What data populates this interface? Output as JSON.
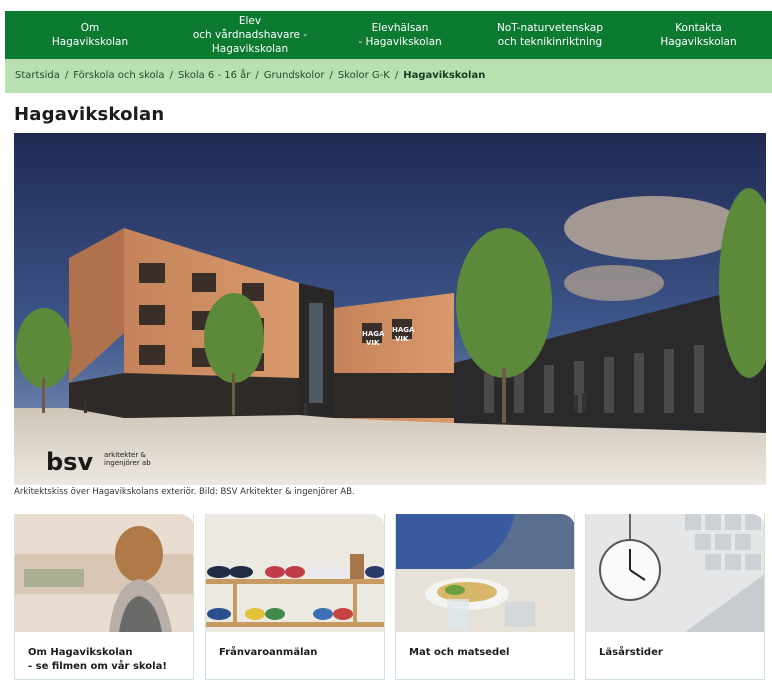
{
  "nav": {
    "items": [
      {
        "label": "Om\nHagavikskolan"
      },
      {
        "label": "Elev\noch vårdnadshavare -\nHagavikskolan"
      },
      {
        "label": "Elevhälsan\n- Hagavikskolan"
      },
      {
        "label": "NoT-naturvetenskap\noch teknikinriktning"
      },
      {
        "label": "Kontakta\nHagavikskolan"
      }
    ]
  },
  "breadcrumb": {
    "items": [
      "Startsida",
      "Förskola och skola",
      "Skola 6 - 16 år",
      "Grundskolor",
      "Skolor G-K"
    ],
    "separator": "/",
    "current": "Hagavikskolan"
  },
  "page": {
    "title": "Hagavikskolan"
  },
  "hero": {
    "logo_main": "bsv",
    "logo_sub": "arkitekter & ingenjörer ab",
    "building_sign_1": "HAGA",
    "building_sign_2": "VIK",
    "caption": "Arkitektskiss över Hagavikskolans exteriör. Bild: BSV Arkitekter & ingenjörer AB."
  },
  "cards": [
    {
      "title": "Om Hagavikskolan\n- se filmen om vår skola!"
    },
    {
      "title": "Frånvaroanmälan"
    },
    {
      "title": "Mat och matsedel"
    },
    {
      "title": "Läsårstider"
    }
  ],
  "colors": {
    "nav_bg": "#0d7a32",
    "breadcrumb_bg": "#b9e0b1",
    "card_border": "#cfe3cf"
  }
}
